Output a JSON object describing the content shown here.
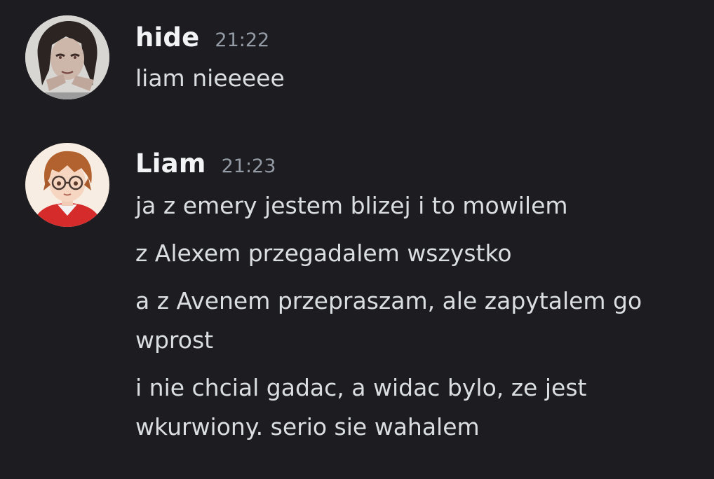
{
  "messages": [
    {
      "author": "hide",
      "time": "21:22",
      "lines": [
        "liam nieeeee"
      ]
    },
    {
      "author": "Liam",
      "time": "21:23",
      "lines": [
        "ja z emery jestem blizej i to mowilem",
        "z Alexem przegadalem wszystko",
        "a z Avenem przepraszam, ale zapytalem go wprost",
        "i nie chcial gadac, a widac bylo, ze jest wkurwiony. serio sie wahalem"
      ]
    }
  ]
}
